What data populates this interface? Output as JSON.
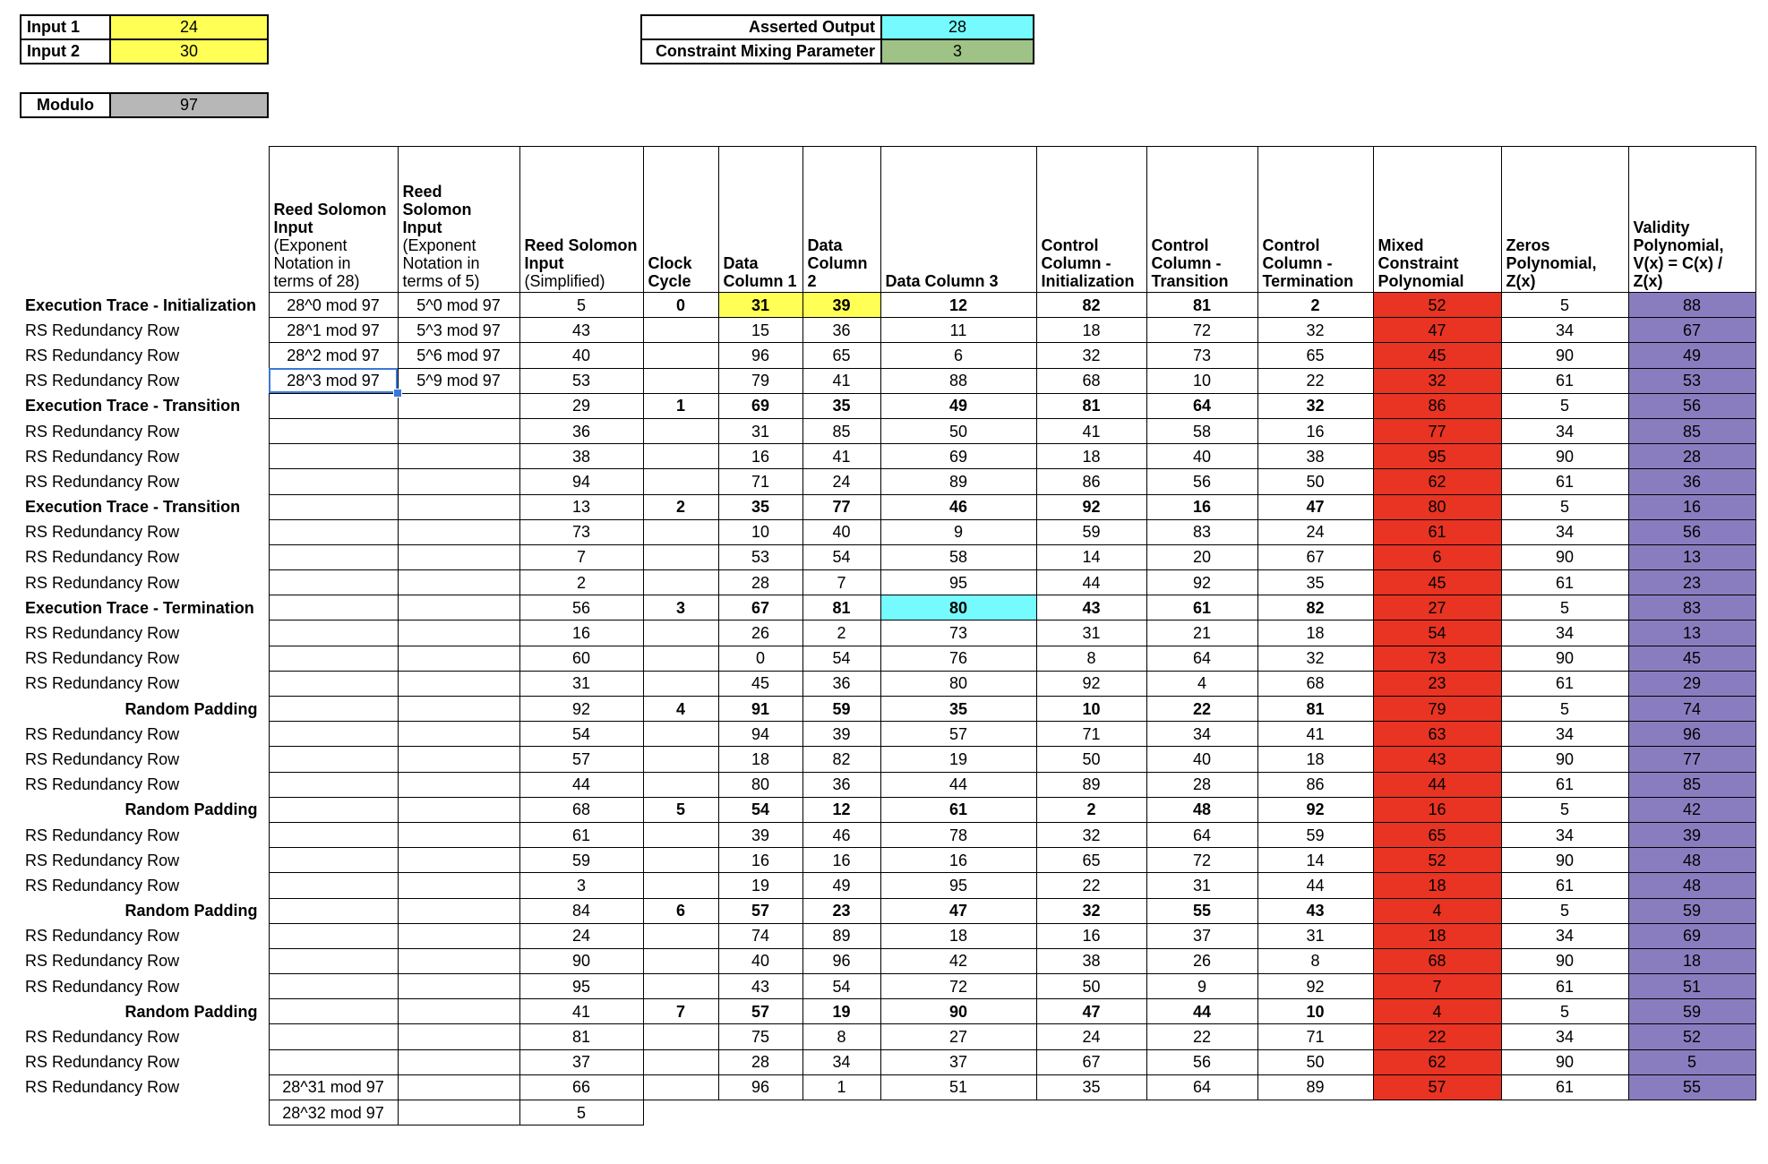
{
  "params": {
    "input1_label": "Input 1",
    "input1_value": "24",
    "input2_label": "Input 2",
    "input2_value": "30",
    "modulo_label": "Modulo",
    "modulo_value": "97",
    "asserted_output_label": "Asserted Output",
    "asserted_output_value": "28",
    "mixing_label": "Constraint Mixing Parameter",
    "mixing_value": "3"
  },
  "colors": {
    "input_yellow": "#ffff55",
    "output_cyan": "#75fbfd",
    "mixing_green": "#9fc386",
    "modulo_grey": "#b7b7b7",
    "mixed_red": "#e93323",
    "validity_purple": "#8a7dbf",
    "selection_blue": "#3c78d8"
  },
  "headers": [
    {
      "title": "Reed Solomon Input",
      "sub": "(Exponent Notation in terms of 28)"
    },
    {
      "title": "Reed Solomon Input",
      "sub": "(Exponent Notation in terms of 5)"
    },
    {
      "title": "Reed Solomon Input",
      "sub": "(Simplified)"
    },
    {
      "title": "Clock Cycle",
      "sub": ""
    },
    {
      "title": "Data Column 1",
      "sub": ""
    },
    {
      "title": "Data Column 2",
      "sub": ""
    },
    {
      "title": "Data Column 3",
      "sub": ""
    },
    {
      "title": "Control Column - Initialization",
      "sub": ""
    },
    {
      "title": "Control Column - Transition",
      "sub": ""
    },
    {
      "title": "Control Column - Termination",
      "sub": ""
    },
    {
      "title": "Mixed Constraint Polynomial",
      "sub": ""
    },
    {
      "title": "Zeros Polynomial, Z(x)",
      "sub": ""
    },
    {
      "title": "Validity Polynomial, V(x) = C(x) / Z(x)",
      "sub": ""
    }
  ],
  "rows": [
    {
      "label": "Execution Trace - Initialization",
      "type": "trace",
      "rs28": "28^0 mod 97",
      "rs5": "5^0 mod 97",
      "rs": "5",
      "clock": "0",
      "dc1": "31",
      "dc2": "39",
      "dc3": "12",
      "cci": "82",
      "cct": "81",
      "ccterm": "2",
      "mixed": "52",
      "zeros": "5",
      "valid": "88"
    },
    {
      "label": "RS Redundancy Row",
      "type": "rs",
      "rs28": "28^1 mod 97",
      "rs5": "5^3 mod 97",
      "rs": "43",
      "clock": "",
      "dc1": "15",
      "dc2": "36",
      "dc3": "11",
      "cci": "18",
      "cct": "72",
      "ccterm": "32",
      "mixed": "47",
      "zeros": "34",
      "valid": "67"
    },
    {
      "label": "RS Redundancy Row",
      "type": "rs",
      "rs28": "28^2 mod 97",
      "rs5": "5^6 mod 97",
      "rs": "40",
      "clock": "",
      "dc1": "96",
      "dc2": "65",
      "dc3": "6",
      "cci": "32",
      "cct": "73",
      "ccterm": "65",
      "mixed": "45",
      "zeros": "90",
      "valid": "49"
    },
    {
      "label": "RS Redundancy Row",
      "type": "rs",
      "rs28": "28^3 mod 97",
      "rs5": "5^9 mod 97",
      "rs": "53",
      "clock": "",
      "dc1": "79",
      "dc2": "41",
      "dc3": "88",
      "cci": "68",
      "cct": "10",
      "ccterm": "22",
      "mixed": "32",
      "zeros": "61",
      "valid": "53"
    },
    {
      "label": "Execution Trace - Transition",
      "type": "trace",
      "rs28": "",
      "rs5": "",
      "rs": "29",
      "clock": "1",
      "dc1": "69",
      "dc2": "35",
      "dc3": "49",
      "cci": "81",
      "cct": "64",
      "ccterm": "32",
      "mixed": "86",
      "zeros": "5",
      "valid": "56"
    },
    {
      "label": "RS Redundancy Row",
      "type": "rs",
      "rs28": "",
      "rs5": "",
      "rs": "36",
      "clock": "",
      "dc1": "31",
      "dc2": "85",
      "dc3": "50",
      "cci": "41",
      "cct": "58",
      "ccterm": "16",
      "mixed": "77",
      "zeros": "34",
      "valid": "85"
    },
    {
      "label": "RS Redundancy Row",
      "type": "rs",
      "rs28": "",
      "rs5": "",
      "rs": "38",
      "clock": "",
      "dc1": "16",
      "dc2": "41",
      "dc3": "69",
      "cci": "18",
      "cct": "40",
      "ccterm": "38",
      "mixed": "95",
      "zeros": "90",
      "valid": "28"
    },
    {
      "label": "RS Redundancy Row",
      "type": "rs",
      "rs28": "",
      "rs5": "",
      "rs": "94",
      "clock": "",
      "dc1": "71",
      "dc2": "24",
      "dc3": "89",
      "cci": "86",
      "cct": "56",
      "ccterm": "50",
      "mixed": "62",
      "zeros": "61",
      "valid": "36"
    },
    {
      "label": "Execution Trace - Transition",
      "type": "trace",
      "rs28": "",
      "rs5": "",
      "rs": "13",
      "clock": "2",
      "dc1": "35",
      "dc2": "77",
      "dc3": "46",
      "cci": "92",
      "cct": "16",
      "ccterm": "47",
      "mixed": "80",
      "zeros": "5",
      "valid": "16"
    },
    {
      "label": "RS Redundancy Row",
      "type": "rs",
      "rs28": "",
      "rs5": "",
      "rs": "73",
      "clock": "",
      "dc1": "10",
      "dc2": "40",
      "dc3": "9",
      "cci": "59",
      "cct": "83",
      "ccterm": "24",
      "mixed": "61",
      "zeros": "34",
      "valid": "56"
    },
    {
      "label": "RS Redundancy Row",
      "type": "rs",
      "rs28": "",
      "rs5": "",
      "rs": "7",
      "clock": "",
      "dc1": "53",
      "dc2": "54",
      "dc3": "58",
      "cci": "14",
      "cct": "20",
      "ccterm": "67",
      "mixed": "6",
      "zeros": "90",
      "valid": "13"
    },
    {
      "label": "RS Redundancy Row",
      "type": "rs",
      "rs28": "",
      "rs5": "",
      "rs": "2",
      "clock": "",
      "dc1": "28",
      "dc2": "7",
      "dc3": "95",
      "cci": "44",
      "cct": "92",
      "ccterm": "35",
      "mixed": "45",
      "zeros": "61",
      "valid": "23"
    },
    {
      "label": "Execution Trace - Termination",
      "type": "trace",
      "rs28": "",
      "rs5": "",
      "rs": "56",
      "clock": "3",
      "dc1": "67",
      "dc2": "81",
      "dc3": "80",
      "cci": "43",
      "cct": "61",
      "ccterm": "82",
      "mixed": "27",
      "zeros": "5",
      "valid": "83"
    },
    {
      "label": "RS Redundancy Row",
      "type": "rs",
      "rs28": "",
      "rs5": "",
      "rs": "16",
      "clock": "",
      "dc1": "26",
      "dc2": "2",
      "dc3": "73",
      "cci": "31",
      "cct": "21",
      "ccterm": "18",
      "mixed": "54",
      "zeros": "34",
      "valid": "13"
    },
    {
      "label": "RS Redundancy Row",
      "type": "rs",
      "rs28": "",
      "rs5": "",
      "rs": "60",
      "clock": "",
      "dc1": "0",
      "dc2": "54",
      "dc3": "76",
      "cci": "8",
      "cct": "64",
      "ccterm": "32",
      "mixed": "73",
      "zeros": "90",
      "valid": "45"
    },
    {
      "label": "RS Redundancy Row",
      "type": "rs",
      "rs28": "",
      "rs5": "",
      "rs": "31",
      "clock": "",
      "dc1": "45",
      "dc2": "36",
      "dc3": "80",
      "cci": "92",
      "cct": "4",
      "ccterm": "68",
      "mixed": "23",
      "zeros": "61",
      "valid": "29"
    },
    {
      "label": "Random Padding",
      "type": "padding",
      "rs28": "",
      "rs5": "",
      "rs": "92",
      "clock": "4",
      "dc1": "91",
      "dc2": "59",
      "dc3": "35",
      "cci": "10",
      "cct": "22",
      "ccterm": "81",
      "mixed": "79",
      "zeros": "5",
      "valid": "74"
    },
    {
      "label": "RS Redundancy Row",
      "type": "rs",
      "rs28": "",
      "rs5": "",
      "rs": "54",
      "clock": "",
      "dc1": "94",
      "dc2": "39",
      "dc3": "57",
      "cci": "71",
      "cct": "34",
      "ccterm": "41",
      "mixed": "63",
      "zeros": "34",
      "valid": "96"
    },
    {
      "label": "RS Redundancy Row",
      "type": "rs",
      "rs28": "",
      "rs5": "",
      "rs": "57",
      "clock": "",
      "dc1": "18",
      "dc2": "82",
      "dc3": "19",
      "cci": "50",
      "cct": "40",
      "ccterm": "18",
      "mixed": "43",
      "zeros": "90",
      "valid": "77"
    },
    {
      "label": "RS Redundancy Row",
      "type": "rs",
      "rs28": "",
      "rs5": "",
      "rs": "44",
      "clock": "",
      "dc1": "80",
      "dc2": "36",
      "dc3": "44",
      "cci": "89",
      "cct": "28",
      "ccterm": "86",
      "mixed": "44",
      "zeros": "61",
      "valid": "85"
    },
    {
      "label": "Random Padding",
      "type": "padding",
      "rs28": "",
      "rs5": "",
      "rs": "68",
      "clock": "5",
      "dc1": "54",
      "dc2": "12",
      "dc3": "61",
      "cci": "2",
      "cct": "48",
      "ccterm": "92",
      "mixed": "16",
      "zeros": "5",
      "valid": "42"
    },
    {
      "label": "RS Redundancy Row",
      "type": "rs",
      "rs28": "",
      "rs5": "",
      "rs": "61",
      "clock": "",
      "dc1": "39",
      "dc2": "46",
      "dc3": "78",
      "cci": "32",
      "cct": "64",
      "ccterm": "59",
      "mixed": "65",
      "zeros": "34",
      "valid": "39"
    },
    {
      "label": "RS Redundancy Row",
      "type": "rs",
      "rs28": "",
      "rs5": "",
      "rs": "59",
      "clock": "",
      "dc1": "16",
      "dc2": "16",
      "dc3": "16",
      "cci": "65",
      "cct": "72",
      "ccterm": "14",
      "mixed": "52",
      "zeros": "90",
      "valid": "48"
    },
    {
      "label": "RS Redundancy Row",
      "type": "rs",
      "rs28": "",
      "rs5": "",
      "rs": "3",
      "clock": "",
      "dc1": "19",
      "dc2": "49",
      "dc3": "95",
      "cci": "22",
      "cct": "31",
      "ccterm": "44",
      "mixed": "18",
      "zeros": "61",
      "valid": "48"
    },
    {
      "label": "Random Padding",
      "type": "padding",
      "rs28": "",
      "rs5": "",
      "rs": "84",
      "clock": "6",
      "dc1": "57",
      "dc2": "23",
      "dc3": "47",
      "cci": "32",
      "cct": "55",
      "ccterm": "43",
      "mixed": "4",
      "zeros": "5",
      "valid": "59"
    },
    {
      "label": "RS Redundancy Row",
      "type": "rs",
      "rs28": "",
      "rs5": "",
      "rs": "24",
      "clock": "",
      "dc1": "74",
      "dc2": "89",
      "dc3": "18",
      "cci": "16",
      "cct": "37",
      "ccterm": "31",
      "mixed": "18",
      "zeros": "34",
      "valid": "69"
    },
    {
      "label": "RS Redundancy Row",
      "type": "rs",
      "rs28": "",
      "rs5": "",
      "rs": "90",
      "clock": "",
      "dc1": "40",
      "dc2": "96",
      "dc3": "42",
      "cci": "38",
      "cct": "26",
      "ccterm": "8",
      "mixed": "68",
      "zeros": "90",
      "valid": "18"
    },
    {
      "label": "RS Redundancy Row",
      "type": "rs",
      "rs28": "",
      "rs5": "",
      "rs": "95",
      "clock": "",
      "dc1": "43",
      "dc2": "54",
      "dc3": "72",
      "cci": "50",
      "cct": "9",
      "ccterm": "92",
      "mixed": "7",
      "zeros": "61",
      "valid": "51"
    },
    {
      "label": "Random Padding",
      "type": "padding",
      "rs28": "",
      "rs5": "",
      "rs": "41",
      "clock": "7",
      "dc1": "57",
      "dc2": "19",
      "dc3": "90",
      "cci": "47",
      "cct": "44",
      "ccterm": "10",
      "mixed": "4",
      "zeros": "5",
      "valid": "59"
    },
    {
      "label": "RS Redundancy Row",
      "type": "rs",
      "rs28": "",
      "rs5": "",
      "rs": "81",
      "clock": "",
      "dc1": "75",
      "dc2": "8",
      "dc3": "27",
      "cci": "24",
      "cct": "22",
      "ccterm": "71",
      "mixed": "22",
      "zeros": "34",
      "valid": "52"
    },
    {
      "label": "RS Redundancy Row",
      "type": "rs",
      "rs28": "",
      "rs5": "",
      "rs": "37",
      "clock": "",
      "dc1": "28",
      "dc2": "34",
      "dc3": "37",
      "cci": "67",
      "cct": "56",
      "ccterm": "50",
      "mixed": "62",
      "zeros": "90",
      "valid": "5"
    },
    {
      "label": "RS Redundancy Row",
      "type": "rs",
      "rs28": "28^31 mod 97",
      "rs5": "",
      "rs": "66",
      "clock": "",
      "dc1": "96",
      "dc2": "1",
      "dc3": "51",
      "cci": "35",
      "cct": "64",
      "ccterm": "89",
      "mixed": "57",
      "zeros": "61",
      "valid": "55"
    }
  ],
  "extra_row": {
    "rs28": "28^32 mod 97",
    "rs5": "",
    "rs": "5"
  },
  "highlights": {
    "yellow_cells": [
      [
        0,
        "dc1"
      ],
      [
        0,
        "dc2"
      ]
    ],
    "cyan_cells": [
      [
        12,
        "dc3"
      ]
    ],
    "selected_cell": [
      3,
      "rs28"
    ]
  }
}
